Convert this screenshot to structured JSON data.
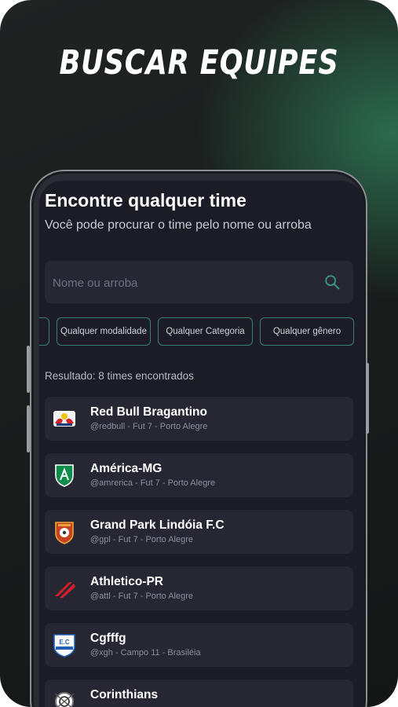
{
  "promo": {
    "headline": "BUSCAR EQUIPES"
  },
  "screen": {
    "title": "Encontre qualquer time",
    "subtitle": "Você pode procurar o time pelo nome ou arroba",
    "search": {
      "placeholder": "Nome ou arroba",
      "value": ""
    },
    "filters": [
      "Qualquer modalidade",
      "Qualquer Categoria",
      "Qualquer gênero"
    ],
    "result_text": "Resultado: 8 times encontrados",
    "teams": [
      {
        "name": "Red Bull Bragantino",
        "meta": "@redbull - Fut 7 - Porto Alegre",
        "icon": "red-bull-crest"
      },
      {
        "name": "América-MG",
        "meta": "@amrerica - Fut 7 - Porto Alegre",
        "icon": "america-mg-crest"
      },
      {
        "name": "Grand Park Lindóia F.C",
        "meta": "@gpl - Fut 7 - Porto Alegre",
        "icon": "grand-park-crest"
      },
      {
        "name": "Athletico-PR",
        "meta": "@attl - Fut 7 - Porto Alegre",
        "icon": "athletico-crest"
      },
      {
        "name": "Cgfffg",
        "meta": "@xgh - Campo 11 - Brasiléia",
        "icon": "ec-crest"
      },
      {
        "name": "Corinthians",
        "meta": "",
        "icon": "corinthians-crest"
      }
    ]
  },
  "colors": {
    "accent": "#3a7e6c",
    "screen_bg": "#1c1c26",
    "card_bg": "#262733"
  }
}
